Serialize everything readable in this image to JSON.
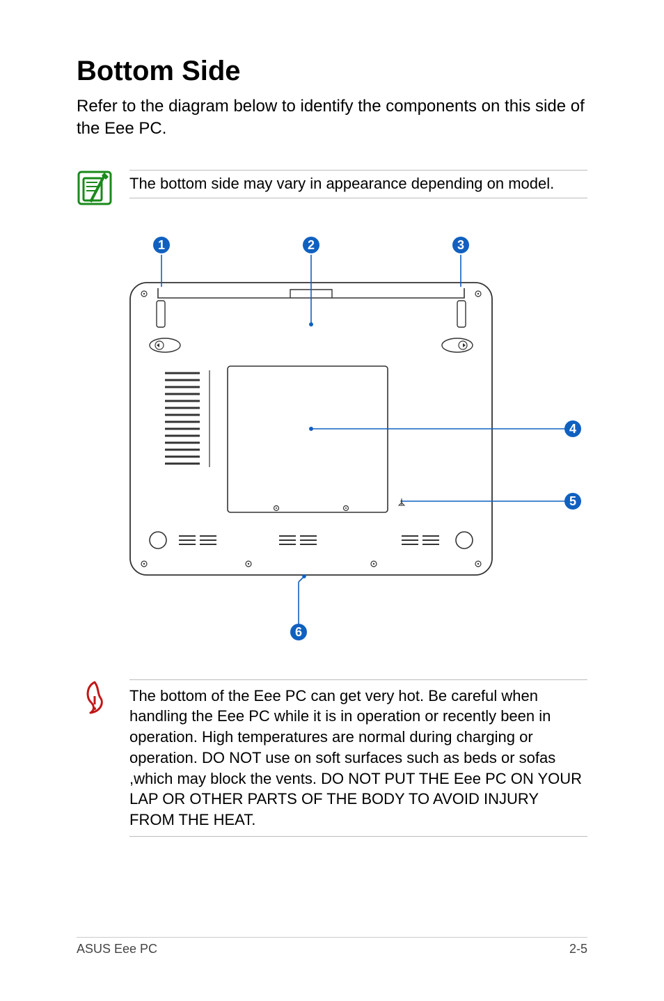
{
  "title": "Bottom Side",
  "intro": "Refer to the diagram below to identify the components on this side of the Eee PC.",
  "note_appearance": "The bottom side may vary in appearance depending on model.",
  "warning_heat": "The bottom of the Eee PC can get very hot. Be careful when handling the Eee PC while it is in operation or recently been in operation. High temperatures are normal during charging or operation. DO NOT use on soft surfaces such as beds or sofas ,which may block the vents. DO NOT PUT THE Eee PC ON YOUR LAP OR OTHER PARTS OF THE BODY TO AVOID INJURY FROM THE HEAT.",
  "callouts": {
    "c1": "1",
    "c2": "2",
    "c3": "3",
    "c4": "4",
    "c5": "5",
    "c6": "6"
  },
  "footer": {
    "left": "ASUS Eee PC",
    "right": "2-5"
  }
}
